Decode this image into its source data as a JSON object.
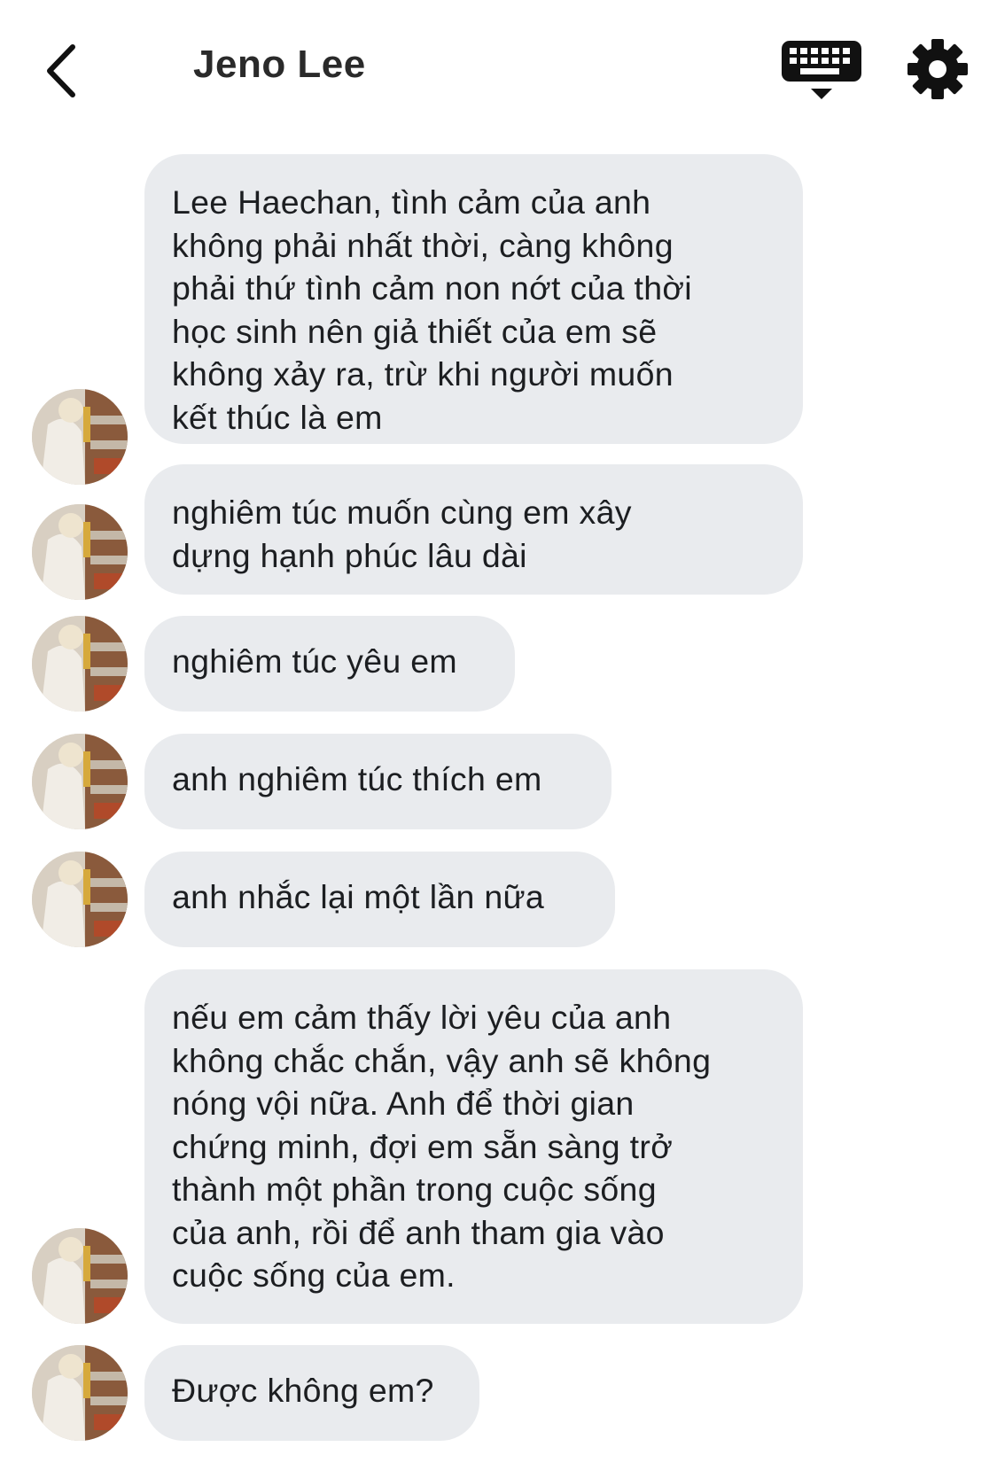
{
  "header": {
    "title": "Jeno Lee",
    "back_icon": "chevron-left-icon",
    "keyboard_icon": "keyboard-icon",
    "settings_icon": "gear-icon"
  },
  "messages": [
    {
      "text": "Lee Haechan, tình cảm của anh\nkhông phải nhất thời, càng không\nphải thứ tình cảm non nớt của thời\nhọc sinh nên giả thiết của em sẽ\nkhông xảy ra, trừ khi người muốn\nkết thúc là em"
    },
    {
      "text": "nghiêm túc muốn cùng em xây\ndựng hạnh phúc lâu dài"
    },
    {
      "text": "nghiêm túc yêu em"
    },
    {
      "text": "anh nghiêm túc thích em"
    },
    {
      "text": "anh nhắc lại một lần nữa"
    },
    {
      "text": "nếu em cảm thấy lời yêu của anh\nkhông chắc chắn, vậy anh sẽ không\nnóng vội nữa. Anh để thời gian\nchứng minh, đợi em sẵn sàng trở\nthành một phần trong cuộc sống\ncủa anh, rồi để anh tham gia vào\ncuộc sống của em."
    },
    {
      "text": "Được không em?"
    }
  ],
  "colors": {
    "bubble_bg": "#e9ebee",
    "text": "#1c1e21",
    "icon": "#000000"
  }
}
